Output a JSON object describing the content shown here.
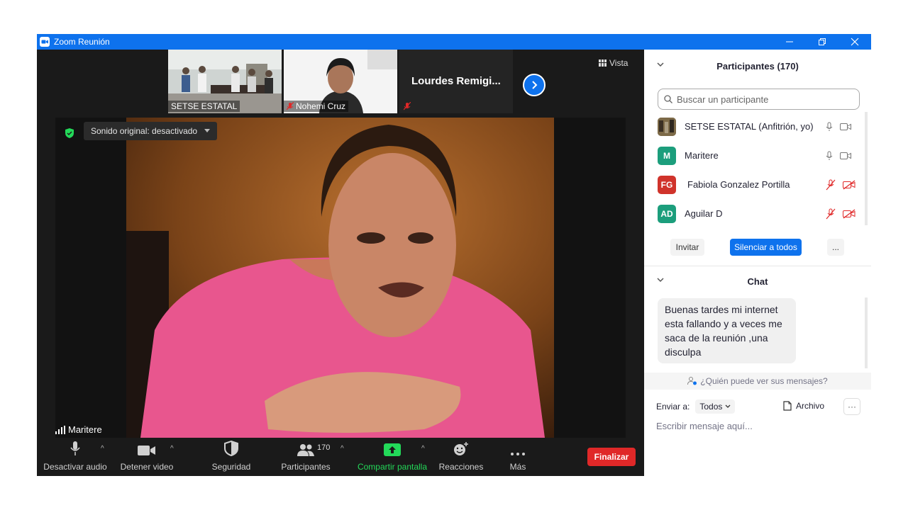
{
  "window": {
    "title": "Zoom Reunión"
  },
  "strip": {
    "thumbs": [
      {
        "label": "SETSE ESTATAL"
      },
      {
        "label": "Nohemi Cruz"
      },
      {
        "label": "Lourdes  Remigi..."
      }
    ],
    "view_label": "Vista"
  },
  "main_video": {
    "sound_label": "Sonido original: desactivado",
    "speaker": "Maritere"
  },
  "toolbar": {
    "audio": "Desactivar audio",
    "video": "Detener video",
    "security": "Seguridad",
    "participants": "Participantes",
    "participants_count": "170",
    "share": "Compartir pantalla",
    "reactions": "Reacciones",
    "more": "Más",
    "end": "Finalizar"
  },
  "participants": {
    "header": "Participantes (170)",
    "search_placeholder": "Buscar un participante",
    "list": [
      {
        "initials": "",
        "name": "SETSE ESTATAL (Anfitrión, yo)",
        "color": "#6b5a3a",
        "muted": false
      },
      {
        "initials": "M",
        "name": "Maritere",
        "color": "#1c9e7c",
        "muted": false
      },
      {
        "initials": "FG",
        "name": "Fabiola Gonzalez Portilla",
        "color": "#d0332b",
        "muted": true
      },
      {
        "initials": "AD",
        "name": "Aguilar D",
        "color": "#1c9e7c",
        "muted": true
      }
    ],
    "invite": "Invitar",
    "mute_all": "Silenciar a todos",
    "more": "..."
  },
  "chat": {
    "header": "Chat",
    "message": "Buenas tardes mi internet esta fallando y a veces me saca de la reunión ,una disculpa",
    "who_can_see": "¿Quién puede ver sus mensajes?",
    "send_to_label": "Enviar a:",
    "send_to_value": "Todos",
    "file_label": "Archivo",
    "more": "···",
    "input_placeholder": "Escribir mensaje aquí..."
  },
  "colors": {
    "accent": "#0e72ed",
    "share_green": "#23d959",
    "end_red": "#e02828"
  }
}
